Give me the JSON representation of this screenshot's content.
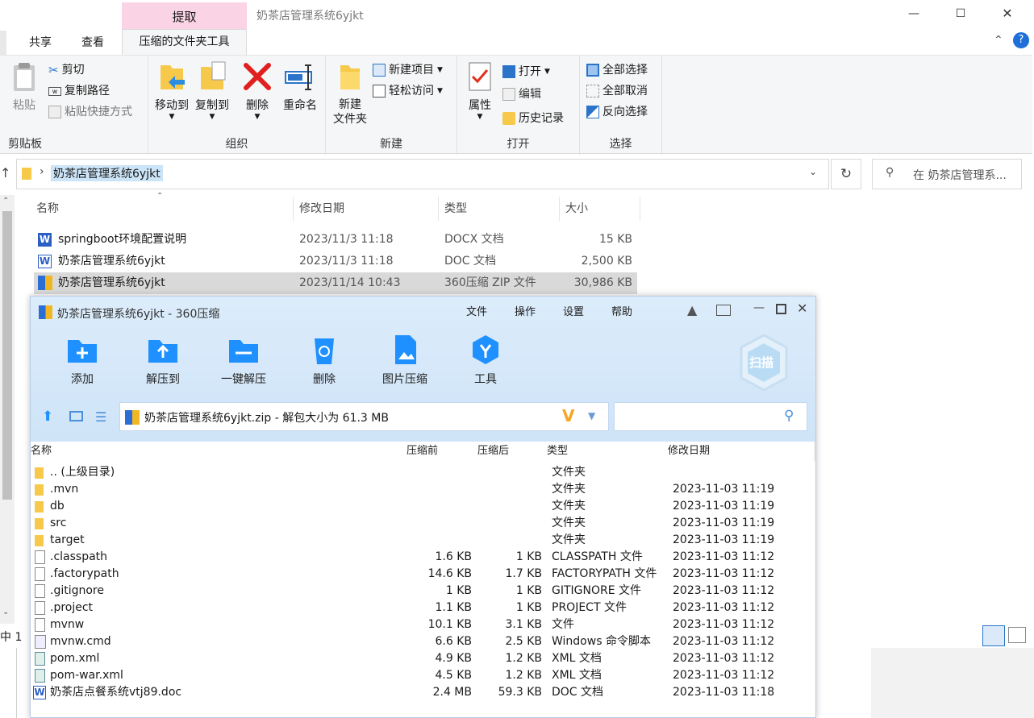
{
  "explorer": {
    "window_title": "奶茶店管理系统6yjkt",
    "tabs": {
      "extract": "提取",
      "share": "共享",
      "view": "查看",
      "zip_tools": "压缩的文件夹工具"
    },
    "ribbon": {
      "clipboard": {
        "label": "剪贴板",
        "paste": "粘贴",
        "cut": "剪切",
        "copy_path": "复制路径",
        "paste_shortcut": "粘贴快捷方式"
      },
      "organize": {
        "label": "组织",
        "move_to": "移动到",
        "copy_to": "复制到",
        "delete": "删除",
        "rename": "重命名"
      },
      "new": {
        "label": "新建",
        "new_folder_1": "新建",
        "new_folder_2": "文件夹",
        "new_item": "新建项目",
        "easy_access": "轻松访问"
      },
      "open": {
        "label": "打开",
        "properties": "属性",
        "open": "打开",
        "edit": "编辑",
        "history": "历史记录"
      },
      "select": {
        "label": "选择",
        "select_all": "全部选择",
        "select_none": "全部取消",
        "invert": "反向选择"
      }
    },
    "address": "奶茶店管理系统6yjkt",
    "search_placeholder": "在 奶茶店管理系...",
    "columns": {
      "name": "名称",
      "date": "修改日期",
      "type": "类型",
      "size": "大小"
    },
    "files": [
      {
        "name": "springboot环境配置说明",
        "date": "2023/11/3 11:18",
        "type": "DOCX 文档",
        "size": "15 KB",
        "icon": "word-icon"
      },
      {
        "name": "奶茶店管理系统6yjkt",
        "date": "2023/11/3 11:18",
        "type": "DOC 文档",
        "size": "2,500 KB",
        "icon": "word-icon"
      },
      {
        "name": "奶茶店管理系统6yjkt",
        "date": "2023/11/14 10:43",
        "type": "360压缩 ZIP 文件",
        "size": "30,986 KB",
        "icon": "zip-icon"
      }
    ],
    "status": "中 1"
  },
  "zip": {
    "title": "奶茶店管理系统6yjkt - 360压缩",
    "menu": {
      "file": "文件",
      "operate": "操作",
      "settings": "设置",
      "help": "帮助"
    },
    "toolbar": {
      "add": "添加",
      "extract_to": "解压到",
      "one_click": "一键解压",
      "delete": "删除",
      "image_compress": "图片压缩",
      "tools": "工具",
      "scan": "扫描"
    },
    "path": "奶茶店管理系统6yjkt.zip - 解包大小为 61.3 MB",
    "columns": {
      "name": "名称",
      "before": "压缩前",
      "after": "压缩后",
      "type": "类型",
      "date": "修改日期"
    },
    "rows": [
      {
        "name": ".. (上级目录)",
        "before": "",
        "after": "",
        "type": "文件夹",
        "date": "",
        "icon": "folder-icon"
      },
      {
        "name": ".mvn",
        "before": "",
        "after": "",
        "type": "文件夹",
        "date": "2023-11-03 11:19",
        "icon": "folder-icon"
      },
      {
        "name": "db",
        "before": "",
        "after": "",
        "type": "文件夹",
        "date": "2023-11-03 11:19",
        "icon": "folder-icon"
      },
      {
        "name": "src",
        "before": "",
        "after": "",
        "type": "文件夹",
        "date": "2023-11-03 11:19",
        "icon": "folder-icon"
      },
      {
        "name": "target",
        "before": "",
        "after": "",
        "type": "文件夹",
        "date": "2023-11-03 11:19",
        "icon": "folder-icon"
      },
      {
        "name": ".classpath",
        "before": "1.6 KB",
        "after": "1 KB",
        "type": "CLASSPATH 文件",
        "date": "2023-11-03 11:12",
        "icon": "file-icon"
      },
      {
        "name": ".factorypath",
        "before": "14.6 KB",
        "after": "1.7 KB",
        "type": "FACTORYPATH 文件",
        "date": "2023-11-03 11:12",
        "icon": "file-icon"
      },
      {
        "name": ".gitignore",
        "before": "1 KB",
        "after": "1 KB",
        "type": "GITIGNORE 文件",
        "date": "2023-11-03 11:12",
        "icon": "file-icon"
      },
      {
        "name": ".project",
        "before": "1.1 KB",
        "after": "1 KB",
        "type": "PROJECT 文件",
        "date": "2023-11-03 11:12",
        "icon": "file-icon"
      },
      {
        "name": "mvnw",
        "before": "10.1 KB",
        "after": "3.1 KB",
        "type": "文件",
        "date": "2023-11-03 11:12",
        "icon": "file-icon"
      },
      {
        "name": "mvnw.cmd",
        "before": "6.6 KB",
        "after": "2.5 KB",
        "type": "Windows 命令脚本",
        "date": "2023-11-03 11:12",
        "icon": "script-icon"
      },
      {
        "name": "pom.xml",
        "before": "4.9 KB",
        "after": "1.2 KB",
        "type": "XML 文档",
        "date": "2023-11-03 11:12",
        "icon": "xml-icon"
      },
      {
        "name": "pom-war.xml",
        "before": "4.5 KB",
        "after": "1.2 KB",
        "type": "XML 文档",
        "date": "2023-11-03 11:12",
        "icon": "xml-icon"
      },
      {
        "name": "奶茶店点餐系统vtj89.doc",
        "before": "2.4 MB",
        "after": "59.3 KB",
        "type": "DOC 文档",
        "date": "2023-11-03 11:18",
        "icon": "word-icon"
      }
    ]
  }
}
